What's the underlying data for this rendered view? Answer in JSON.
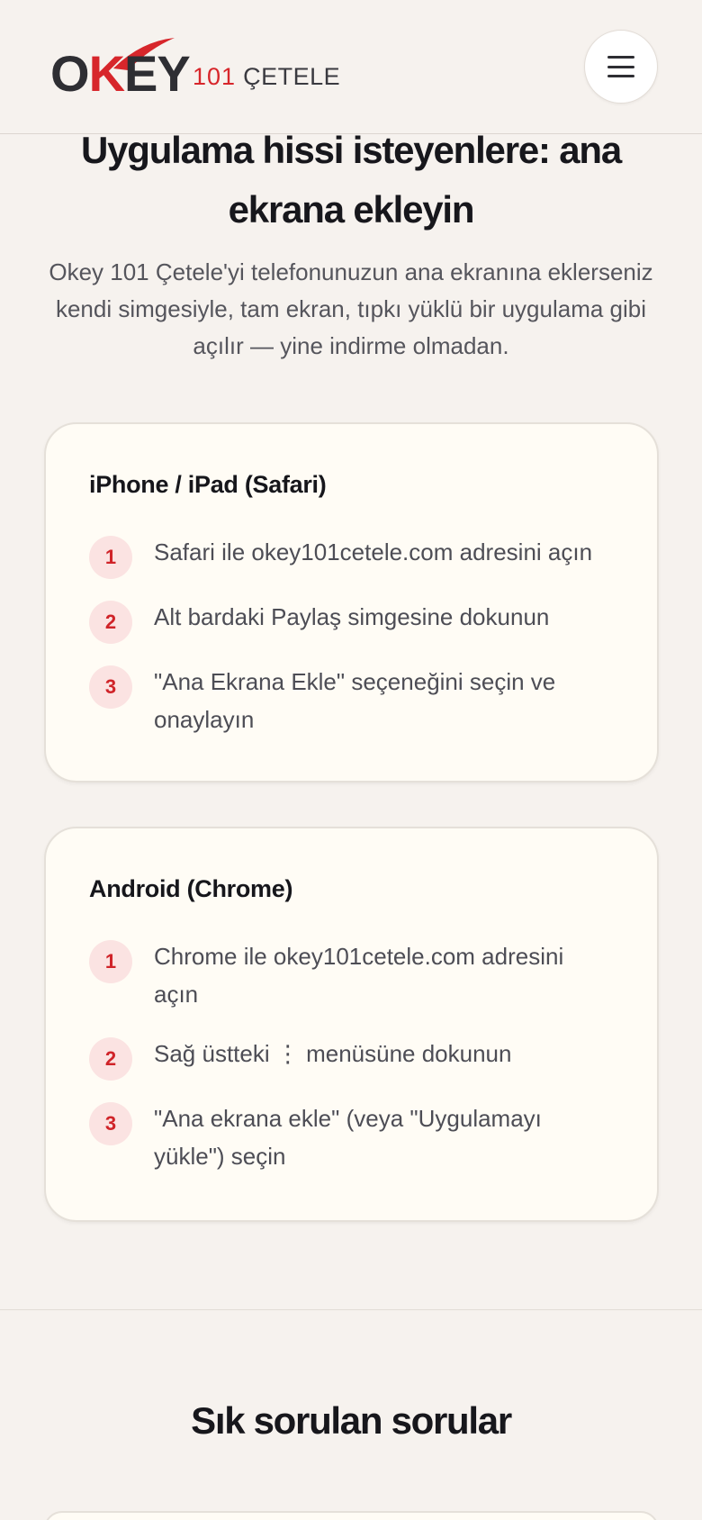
{
  "header": {
    "logo_main_prefix": "O",
    "logo_main_k": "K",
    "logo_main_suffix": "EY",
    "logo_sub_number": "101",
    "logo_sub_text": "ÇETELE",
    "menu_icon": "hamburger-menu-icon"
  },
  "install": {
    "title": "Uygulama hissi isteyenlere: ana ekrana ekleyin",
    "description": "Okey 101 Çetele'yi telefonunuzun ana ekranına eklerseniz kendi simgesiyle, tam ekran, tıpkı yüklü bir uygulama gibi açılır — yine indirme olmadan.",
    "ios": {
      "title": "iPhone / iPad (Safari)",
      "steps": [
        {
          "num": "1",
          "text": "Safari ile okey101cetele.com adresini açın"
        },
        {
          "num": "2",
          "text": "Alt bardaki Paylaş simgesine dokunun"
        },
        {
          "num": "3",
          "text": "\"Ana Ekrana Ekle\" seçeneğini seçin ve onaylayın"
        }
      ]
    },
    "android": {
      "title": "Android (Chrome)",
      "steps": [
        {
          "num": "1",
          "text": "Chrome ile okey101cetele.com adresini açın"
        },
        {
          "num": "2",
          "text": "Sağ üstteki ⋮ menüsüne dokunun"
        },
        {
          "num": "3",
          "text": "\"Ana ekrana ekle\" (veya \"Uygulamayı yükle\") seçin"
        }
      ]
    }
  },
  "faq": {
    "title": "Sık sorulan sorular"
  },
  "colors": {
    "accent": "#d7262b",
    "background": "#f6f2ee",
    "card": "#fffcf5",
    "step_badge": "#fbe3e2"
  }
}
